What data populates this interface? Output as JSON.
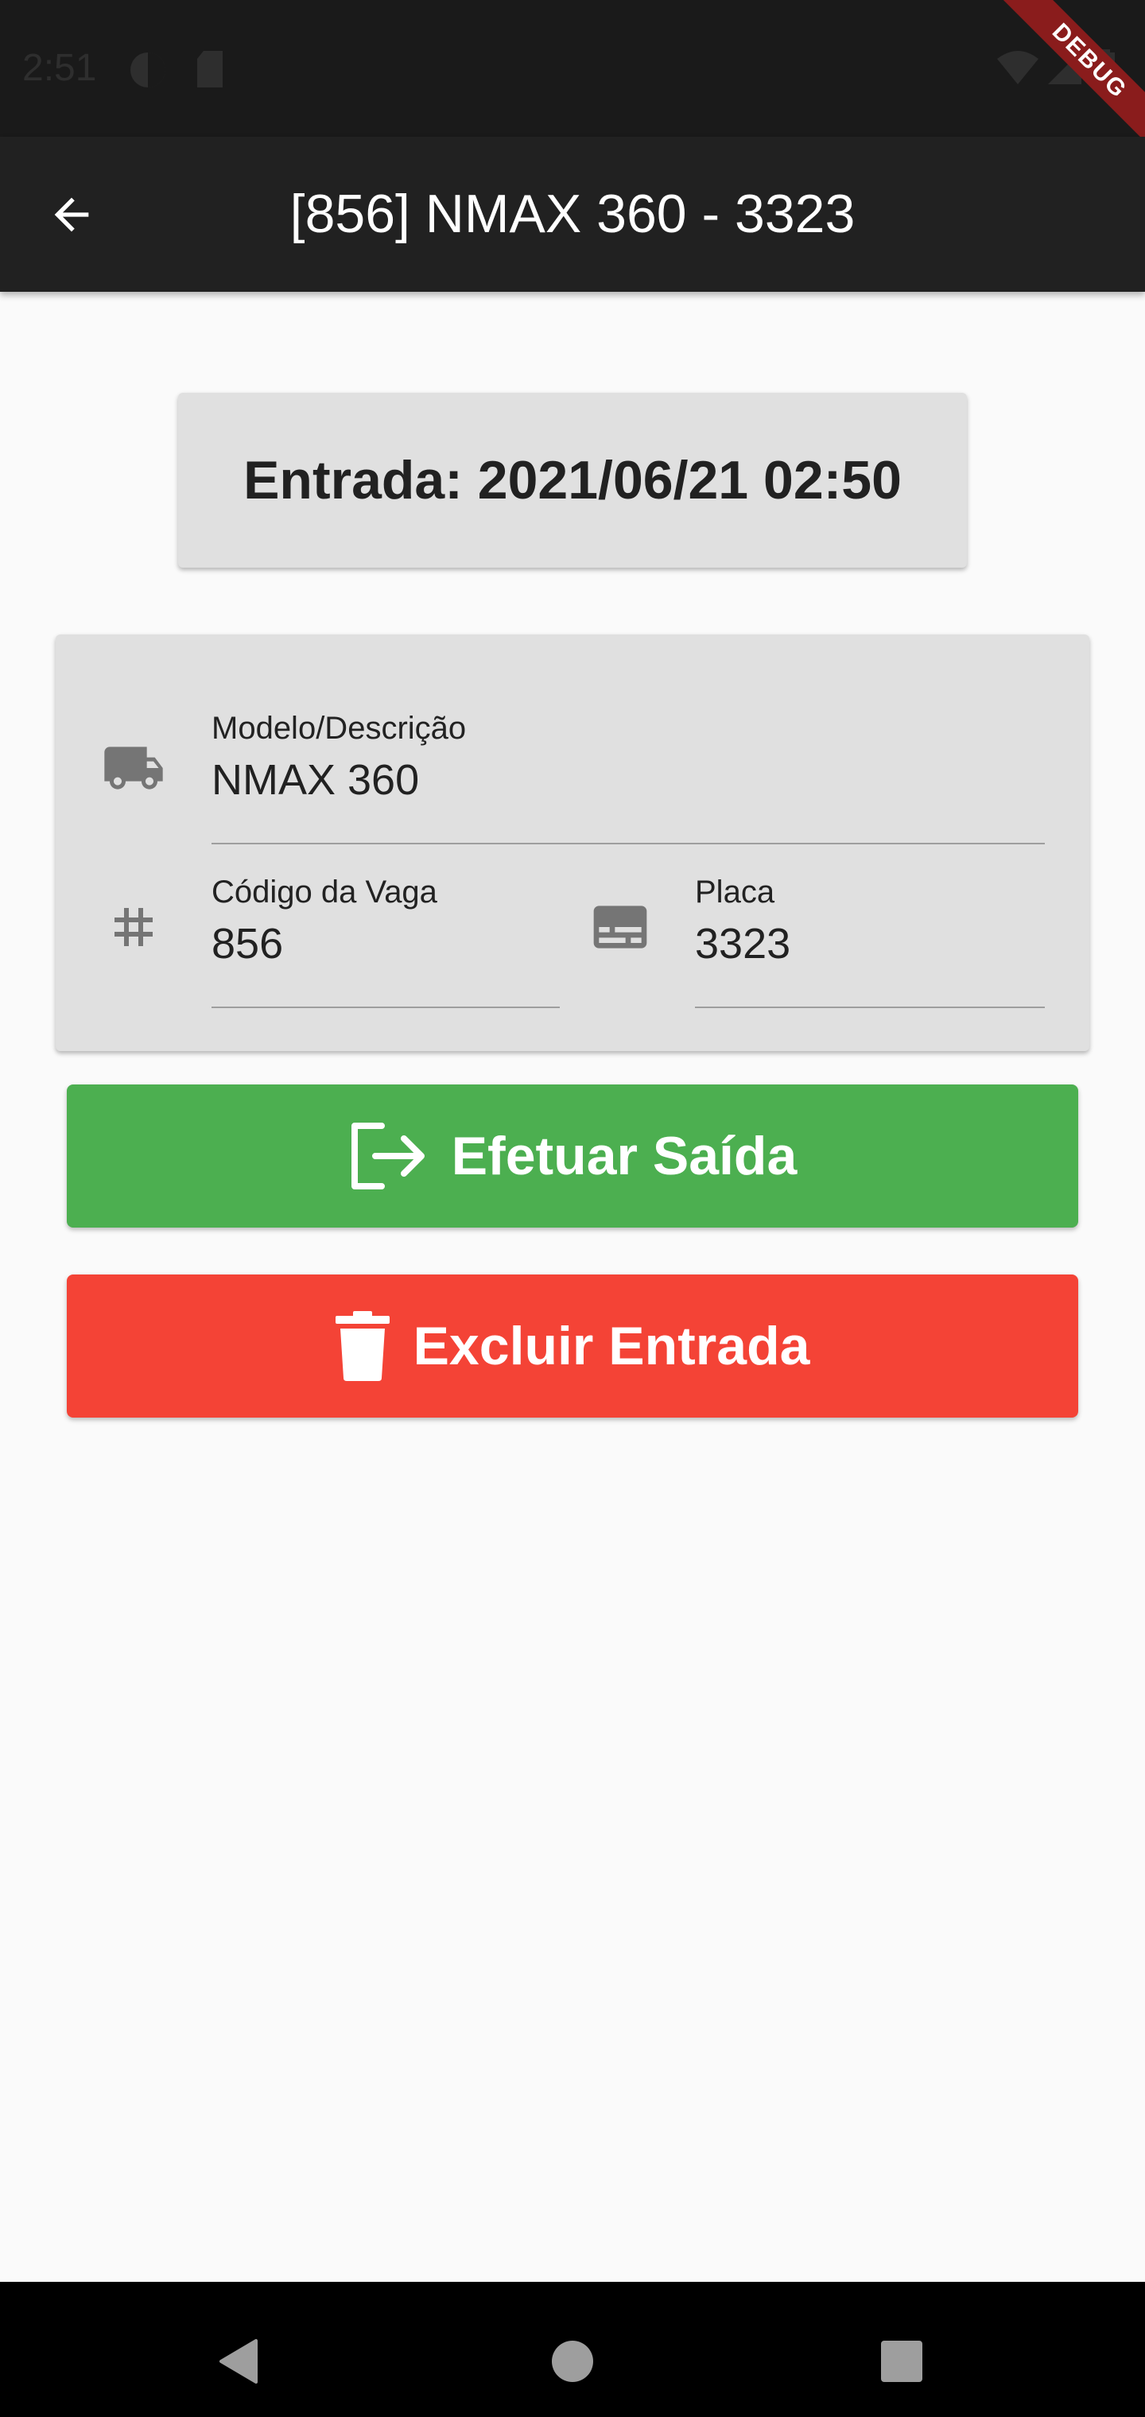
{
  "status_bar": {
    "time": "2:51",
    "icons": [
      "data-saver-icon",
      "sd-card-icon",
      "wifi-icon",
      "signal-icon",
      "battery-icon"
    ],
    "debug_banner": "DEBUG"
  },
  "app_bar": {
    "back_icon": "arrow-back-icon",
    "title": "[856] NMAX 360 - 3323"
  },
  "entry": {
    "text": "Entrada: 2021/06/21 02:50"
  },
  "form": {
    "model": {
      "icon": "truck-icon",
      "label": "Modelo/Descrição",
      "value": "NMAX 360"
    },
    "spot_code": {
      "icon": "hash-icon",
      "label": "Código da Vaga",
      "value": "856"
    },
    "plate": {
      "icon": "subtitles-icon",
      "label": "Placa",
      "value": "3323"
    }
  },
  "buttons": {
    "exit": {
      "icon": "logout-icon",
      "label": "Efetuar Saída",
      "color": "#4caf50"
    },
    "delete": {
      "icon": "trash-icon",
      "label": "Excluir Entrada",
      "color": "#f44336"
    }
  },
  "nav_bar": {
    "icons": [
      "back-triangle-icon",
      "home-circle-icon",
      "recents-square-icon"
    ]
  }
}
